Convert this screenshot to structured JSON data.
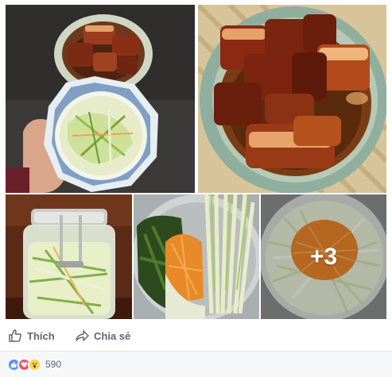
{
  "post": {
    "photos": [
      {
        "name": "pork-and-slaw-photo"
      },
      {
        "name": "braised-pork-photo"
      },
      {
        "name": "pickle-jar-photo"
      },
      {
        "name": "vegetables-bowl-photo"
      },
      {
        "name": "shredded-salad-photo",
        "more_label": "+3"
      }
    ]
  },
  "actions": {
    "like_label": "Thích",
    "share_label": "Chia sẻ"
  },
  "reactions": {
    "icons": [
      "like-icon",
      "love-icon",
      "wow-icon"
    ],
    "count": "590"
  },
  "colors": {
    "text_secondary": "#606770",
    "like_blue": "#5890ff",
    "love_red": "#f25268",
    "wow_yellow": "#fbd44a",
    "footer_bg": "#f6f7f9"
  }
}
